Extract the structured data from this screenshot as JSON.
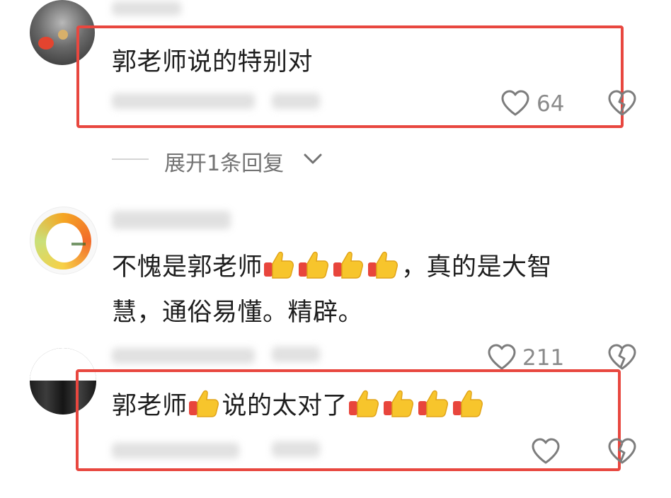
{
  "comments": [
    {
      "text": "郭老师说的特别对",
      "likes": "64"
    },
    {
      "text_before": "不愧是郭老师",
      "text_after": "，真的是大智",
      "text_line2": "慧，通俗易懂。精辟。",
      "likes": "211"
    },
    {
      "text_a": "郭老师",
      "text_b": "说的太对了"
    }
  ],
  "expand_replies": "展开1条回复",
  "colors": {
    "highlight": "#e8473f",
    "thumb": "#f7c52c",
    "cuff": "#e8453c"
  }
}
